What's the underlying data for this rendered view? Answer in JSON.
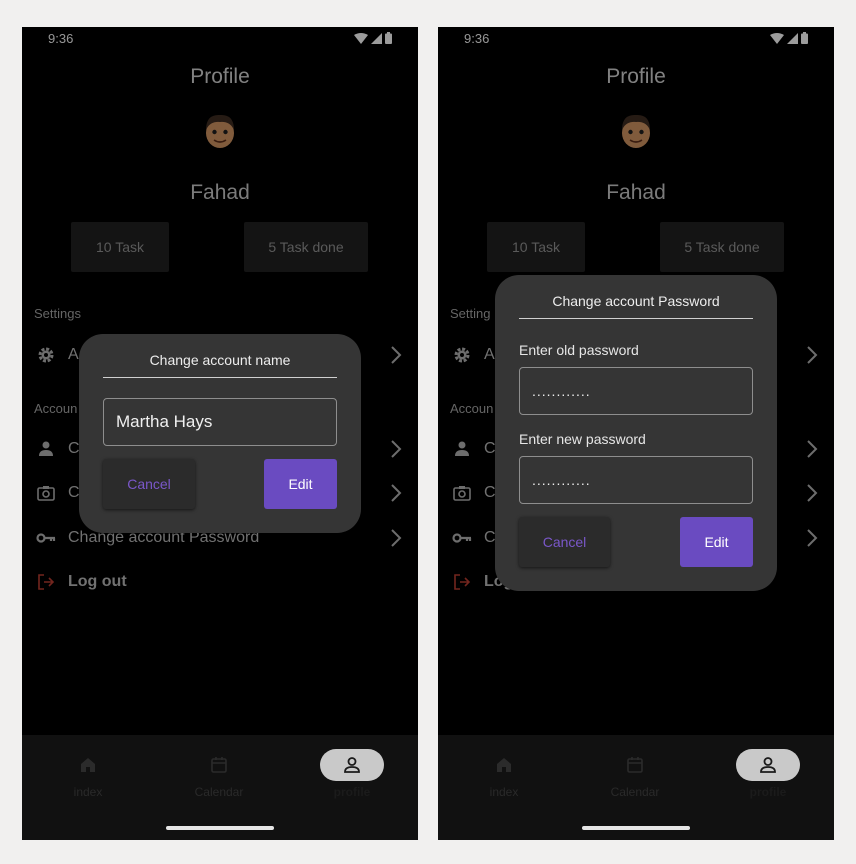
{
  "screens": {
    "left": {
      "status_time": "9:36",
      "title": "Profile",
      "name": "Fahad",
      "stats": {
        "tasks": "10 Task",
        "done": "5 Task done"
      },
      "sections": {
        "settings": "Settings",
        "account": "Accoun"
      },
      "rows": {
        "settings_item": "A",
        "account_item1": "C",
        "account_item2": "C",
        "password": "Change account Password",
        "logout": "Log out"
      },
      "dialog": {
        "title": "Change account name",
        "input_value": "Martha Hays",
        "cancel_label": "Cancel",
        "edit_label": "Edit"
      },
      "nav": {
        "index": "index",
        "calendar": "Calendar",
        "profile": "profile"
      }
    },
    "right": {
      "status_time": "9:36",
      "title": "Profile",
      "name": "Fahad",
      "stats": {
        "tasks": "10 Task",
        "done": "5 Task done"
      },
      "sections": {
        "settings": "Setting",
        "account": "Accoun"
      },
      "rows": {
        "settings_item": "A",
        "account_item1": "C",
        "account_item2": "C",
        "password": "C",
        "logout": "Log"
      },
      "dialog": {
        "title": "Change account Password",
        "old_label": "Enter old password",
        "old_value": "............",
        "new_label": "Enter new password",
        "new_value": "............",
        "cancel_label": "Cancel",
        "edit_label": "Edit"
      },
      "nav": {
        "index": "index",
        "calendar": "Calendar",
        "profile": "profile"
      }
    }
  },
  "icons": {
    "status": [
      "wifi-icon",
      "signal-icon",
      "battery-icon"
    ],
    "rows": [
      "gear-icon",
      "person-icon",
      "camera-icon",
      "key-icon",
      "logout-icon"
    ],
    "nav": [
      "home-icon",
      "calendar-icon",
      "person-outline-icon"
    ],
    "chevron": "chevron-right-icon"
  },
  "colors": {
    "background": "#000000",
    "dialog": "#353535",
    "accent": "#6a4bc1",
    "cancel_text": "#7a57c9",
    "logout_icon": "#c0392b"
  }
}
